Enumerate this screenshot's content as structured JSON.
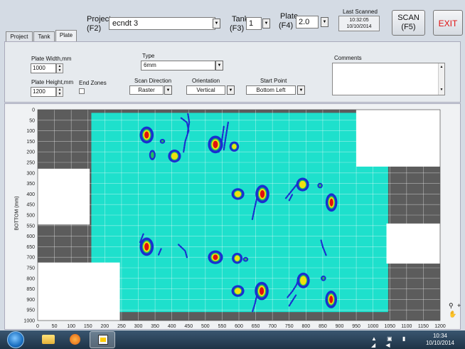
{
  "header": {
    "project_label": "Project",
    "project_key": "(F2)",
    "project_value": "ecndt 3",
    "tank_label": "Tank",
    "tank_key": "(F3)",
    "tank_value": "1",
    "plate_label": "Plate",
    "plate_key": "(F4)",
    "plate_value": "2.0",
    "last_scanned_label": "Last Scanned",
    "last_scanned_time": "10:32:05",
    "last_scanned_date": "10/10/2014",
    "scan_label": "SCAN",
    "scan_key": "(F5)",
    "exit_label": "EXIT"
  },
  "tabs": [
    {
      "label": "Project",
      "active": false
    },
    {
      "label": "Tank",
      "active": false
    },
    {
      "label": "Plate",
      "active": true
    }
  ],
  "settings": {
    "plate_width_label": "Plate Width,mm",
    "plate_width_value": "1000",
    "plate_height_label": "Plate Height,mm",
    "plate_height_value": "1200",
    "end_zones_label": "End Zones",
    "type_label": "Type",
    "type_value": "6mm",
    "scan_direction_label": "Scan Direction",
    "scan_direction_value": "Raster",
    "orientation_label": "Orientation",
    "orientation_value": "Vertical",
    "start_point_label": "Start Point",
    "start_point_value": "Bottom Left",
    "comments_label": "Comments",
    "comments_value": ""
  },
  "colors": {
    "plate": "#1ee0cc",
    "masked": "#5c5c5c",
    "white_zone": "#ffffff",
    "blob_outer": "#1a2fd0",
    "blob_mid": "#f0e010",
    "blob_inner": "#e01010",
    "exit": "#e01010",
    "grid": "#ffffff"
  },
  "chart_data": {
    "type": "heatmap",
    "title": "",
    "xlabel": "",
    "ylabel": "BOTTOM (mm)",
    "xlim": [
      0,
      1200
    ],
    "ylim": [
      0,
      1000
    ],
    "y_inverted": true,
    "grid": true,
    "x_ticks": [
      0,
      50,
      100,
      150,
      200,
      250,
      300,
      350,
      400,
      450,
      500,
      550,
      600,
      650,
      700,
      750,
      800,
      850,
      900,
      950,
      1000,
      1050,
      1100,
      1150,
      1200
    ],
    "y_ticks": [
      0,
      50,
      100,
      150,
      200,
      250,
      300,
      350,
      400,
      450,
      500,
      550,
      600,
      650,
      700,
      750,
      800,
      850,
      900,
      950,
      1000
    ],
    "regions": [
      {
        "kind": "masked",
        "x0": 0,
        "x1": 1200,
        "y0": 0,
        "y1": 1000
      },
      {
        "kind": "plate",
        "x0": 160,
        "x1": 1045,
        "y0": 15,
        "y1": 960
      },
      {
        "kind": "white",
        "x0": 0,
        "x1": 155,
        "y0": 280,
        "y1": 545
      },
      {
        "kind": "white",
        "x0": 0,
        "x1": 245,
        "y0": 725,
        "y1": 1000
      },
      {
        "kind": "white",
        "x0": 950,
        "x1": 1200,
        "y0": 0,
        "y1": 270
      },
      {
        "kind": "white",
        "x0": 1040,
        "x1": 1200,
        "y0": 540,
        "y1": 730
      }
    ],
    "indications": [
      {
        "x": 325,
        "y": 120,
        "rx": 11,
        "ry": 22,
        "level": 2
      },
      {
        "x": 342,
        "y": 215,
        "rx": 4,
        "ry": 12,
        "level": 0
      },
      {
        "x": 408,
        "y": 220,
        "rx": 10,
        "ry": 16,
        "level": 1
      },
      {
        "x": 530,
        "y": 165,
        "rx": 12,
        "ry": 23,
        "level": 2
      },
      {
        "x": 586,
        "y": 175,
        "rx": 7,
        "ry": 12,
        "level": 1
      },
      {
        "x": 597,
        "y": 400,
        "rx": 10,
        "ry": 14,
        "level": 1
      },
      {
        "x": 670,
        "y": 400,
        "rx": 11,
        "ry": 24,
        "level": 2
      },
      {
        "x": 790,
        "y": 355,
        "rx": 10,
        "ry": 17,
        "level": 1
      },
      {
        "x": 876,
        "y": 440,
        "rx": 9,
        "ry": 24,
        "level": 2
      },
      {
        "x": 325,
        "y": 650,
        "rx": 11,
        "ry": 24,
        "level": 2
      },
      {
        "x": 530,
        "y": 700,
        "rx": 12,
        "ry": 17,
        "level": 2
      },
      {
        "x": 595,
        "y": 705,
        "rx": 8,
        "ry": 13,
        "level": 1
      },
      {
        "x": 597,
        "y": 860,
        "rx": 10,
        "ry": 14,
        "level": 1
      },
      {
        "x": 668,
        "y": 860,
        "rx": 11,
        "ry": 24,
        "level": 2
      },
      {
        "x": 792,
        "y": 810,
        "rx": 10,
        "ry": 20,
        "level": 1
      },
      {
        "x": 875,
        "y": 900,
        "rx": 9,
        "ry": 23,
        "level": 2
      },
      {
        "x": 372,
        "y": 150,
        "rx": 3,
        "ry": 4,
        "level": 0
      },
      {
        "x": 620,
        "y": 710,
        "rx": 3,
        "ry": 4,
        "level": 0
      },
      {
        "x": 842,
        "y": 360,
        "rx": 3,
        "ry": 5,
        "level": 0
      },
      {
        "x": 852,
        "y": 800,
        "rx": 3,
        "ry": 5,
        "level": 0
      }
    ],
    "traces": [
      {
        "points": [
          [
            428,
            40
          ],
          [
            445,
            60
          ],
          [
            450,
            100
          ],
          [
            440,
            150
          ],
          [
            435,
            200
          ]
        ]
      },
      {
        "points": [
          [
            448,
            20
          ],
          [
            452,
            60
          ],
          [
            447,
            110
          ]
        ]
      },
      {
        "points": [
          [
            555,
            80
          ],
          [
            548,
            160
          ],
          [
            540,
            200
          ]
        ]
      },
      {
        "points": [
          [
            568,
            60
          ],
          [
            560,
            140
          ],
          [
            555,
            190
          ]
        ]
      },
      {
        "points": [
          [
            655,
            410
          ],
          [
            648,
            460
          ],
          [
            640,
            520
          ]
        ]
      },
      {
        "points": [
          [
            740,
            420
          ],
          [
            755,
            390
          ],
          [
            770,
            360
          ],
          [
            780,
            340
          ]
        ]
      },
      {
        "points": [
          [
            750,
            430
          ],
          [
            760,
            400
          ]
        ]
      },
      {
        "points": [
          [
            420,
            640
          ],
          [
            440,
            670
          ],
          [
            445,
            700
          ]
        ]
      },
      {
        "points": [
          [
            368,
            660
          ],
          [
            360,
            690
          ]
        ]
      },
      {
        "points": [
          [
            655,
            870
          ],
          [
            648,
            920
          ],
          [
            640,
            960
          ]
        ]
      },
      {
        "points": [
          [
            745,
            890
          ],
          [
            760,
            860
          ],
          [
            772,
            830
          ],
          [
            778,
            800
          ]
        ]
      },
      {
        "points": [
          [
            750,
            930
          ],
          [
            762,
            900
          ],
          [
            770,
            880
          ]
        ]
      },
      {
        "points": [
          [
            860,
            690
          ],
          [
            850,
            650
          ],
          [
            845,
            620
          ]
        ]
      },
      {
        "points": [
          [
            315,
            590
          ],
          [
            305,
            630
          ]
        ]
      }
    ]
  },
  "taskbar": {
    "time": "10:34",
    "date": "10/10/2014"
  }
}
